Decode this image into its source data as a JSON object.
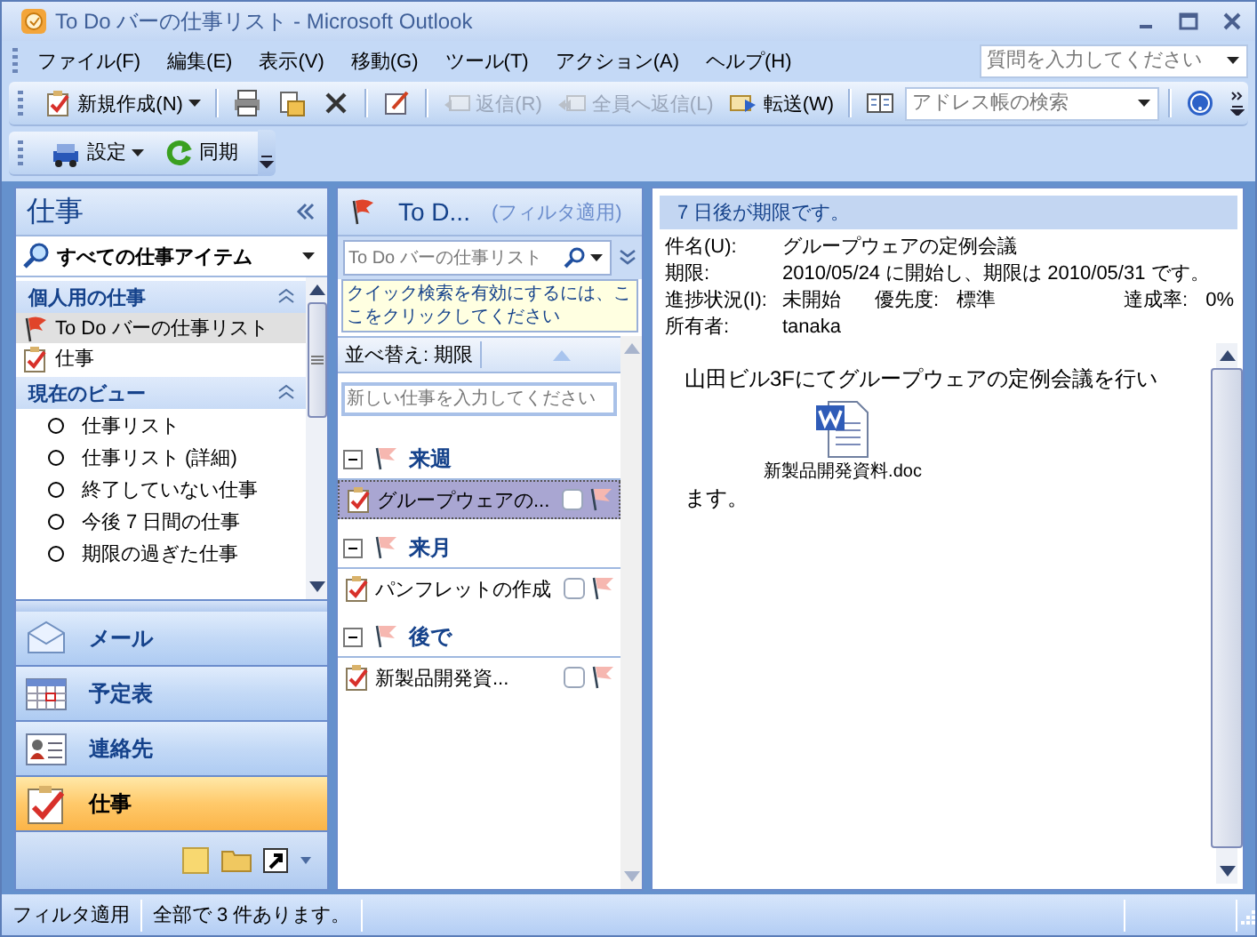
{
  "window": {
    "title": "To Do バーの仕事リスト - Microsoft Outlook"
  },
  "menu": [
    {
      "label": "ファイル(F)"
    },
    {
      "label": "編集(E)"
    },
    {
      "label": "表示(V)"
    },
    {
      "label": "移動(G)"
    },
    {
      "label": "ツール(T)"
    },
    {
      "label": "アクション(A)"
    },
    {
      "label": "ヘルプ(H)"
    }
  ],
  "help_search": {
    "placeholder": "質問を入力してください"
  },
  "toolbar": [
    {
      "label": "新規作成(N)",
      "disabled": false
    },
    {
      "label": "返信(R)",
      "disabled": true
    },
    {
      "label": "全員へ返信(L)",
      "disabled": true
    },
    {
      "label": "転送(W)",
      "disabled": false
    }
  ],
  "address_search": {
    "placeholder": "アドレス帳の検索"
  },
  "toolbar2": [
    {
      "label": "設定"
    },
    {
      "label": "同期"
    }
  ],
  "navigation_pane": {
    "title": "仕事",
    "view_selector": "すべての仕事アイテム",
    "sections": [
      {
        "kind": "folders",
        "title": "個人用の仕事",
        "items": [
          {
            "label": "To Do バーの仕事リスト",
            "selected": true
          },
          {
            "label": "仕事",
            "selected": false
          }
        ]
      },
      {
        "kind": "views",
        "title": "現在のビュー",
        "items": [
          {
            "label": "仕事リスト",
            "checked": false
          },
          {
            "label": "仕事リスト (詳細)",
            "checked": false
          },
          {
            "label": "終了していない仕事",
            "checked": false
          },
          {
            "label": "今後 7 日間の仕事",
            "checked": false
          },
          {
            "label": "期限の過ぎた仕事",
            "checked": false
          }
        ]
      }
    ],
    "buttons": [
      {
        "label": "メール",
        "selected": false
      },
      {
        "label": "予定表",
        "selected": false
      },
      {
        "label": "連絡先",
        "selected": false
      },
      {
        "label": "仕事",
        "selected": true
      }
    ]
  },
  "task_list": {
    "title": "To D...",
    "filter_note": "(フィルタ適用)",
    "search": {
      "placeholder": "To Do バーの仕事リスト"
    },
    "search_hint": "クイック検索を有効にするには、ここをクリックしてください",
    "sort_label": "並べ替え: 期限",
    "new_task": {
      "placeholder": "新しい仕事を入力してください"
    },
    "groups": [
      {
        "title": "来週",
        "expanded": true,
        "tasks": [
          {
            "subject": "グループウェアの...",
            "selected": true,
            "completed": false
          }
        ]
      },
      {
        "title": "来月",
        "expanded": true,
        "tasks": [
          {
            "subject": "パンフレットの作成",
            "selected": false,
            "completed": false
          }
        ]
      },
      {
        "title": "後で",
        "expanded": true,
        "tasks": [
          {
            "subject": "新製品開発資...",
            "selected": false,
            "completed": false
          }
        ]
      }
    ]
  },
  "reading_pane": {
    "info_bar": "7 日後が期限です。",
    "fields": [
      {
        "kind": "text",
        "label": "件名(U):",
        "value": "グループウェアの定例会議"
      },
      {
        "kind": "text",
        "label": "期限:",
        "value": "2010/05/24 に開始し、期限は 2010/05/31 です。"
      },
      {
        "kind": "status",
        "label": "進捗状況(I):",
        "value": "未開始",
        "priority_label": "優先度:",
        "priority": "標準",
        "percent_label": "達成率:",
        "percent": "0%"
      },
      {
        "kind": "text",
        "label": "所有者:",
        "value": "tanaka"
      }
    ],
    "body": {
      "text_before": "山田ビル3Fにてグループウェアの定例会議を行い",
      "attachment": "新製品開発資料.doc",
      "text_after": "ます。"
    }
  },
  "status_bar": [
    "フィルタ適用",
    "全部で 3 件あります。"
  ]
}
